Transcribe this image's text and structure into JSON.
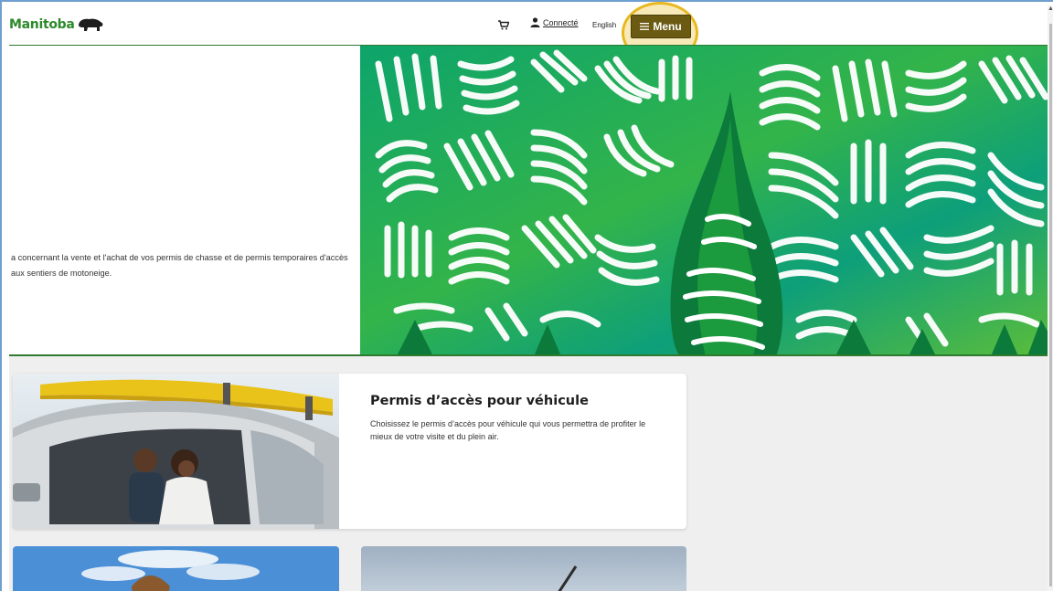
{
  "header": {
    "logo_text": "Manitoba",
    "signin_label": "Connecté",
    "language_label": "English",
    "menu_label": "Menu"
  },
  "hero": {
    "text": "a concernant la vente et l'achat de vos permis de chasse et de permis temporaires d'accès aux sentiers de motoneige."
  },
  "cards": [
    {
      "title": "Permis d’accès pour véhicule",
      "description": "Choisissez le permis d’accès pour véhicule qui vous permettra de profiter le mieux de votre visite et du plein air."
    }
  ],
  "colors": {
    "brand_green": "#2c8a2a",
    "menu_button": "#6b5b12",
    "highlight": "#e8b820"
  },
  "icons": [
    "cart-icon",
    "user-icon",
    "menu-hamburger-icon",
    "bison-icon"
  ]
}
